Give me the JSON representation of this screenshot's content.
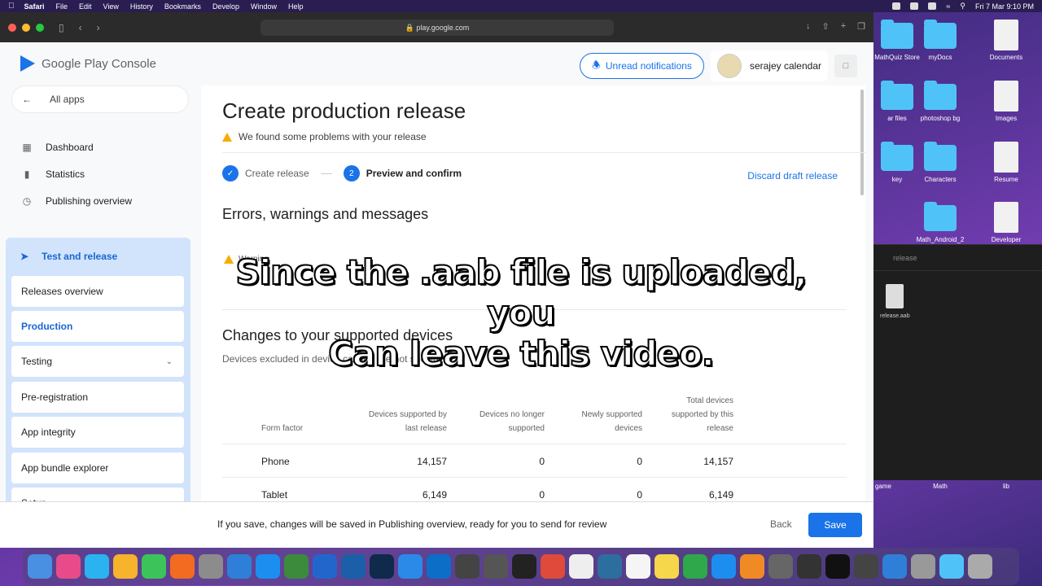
{
  "menubar": {
    "app": "Safari",
    "items": [
      "File",
      "Edit",
      "View",
      "History",
      "Bookmarks",
      "Develop",
      "Window",
      "Help"
    ],
    "datetime": "Fri 7 Mar  9:10 PM"
  },
  "browser": {
    "url": "play.google.com"
  },
  "desktop": {
    "icons": [
      {
        "label": "MathQuiz\nStore",
        "type": "folder"
      },
      {
        "label": "myDocs",
        "type": "folder"
      },
      {
        "label": "Documents",
        "type": "doc"
      },
      {
        "label": "ar files",
        "type": "folder"
      },
      {
        "label": "photoshop bg",
        "type": "folder"
      },
      {
        "label": "Images",
        "type": "doc"
      },
      {
        "label": "key",
        "type": "folder"
      },
      {
        "label": "Characters",
        "type": "folder"
      },
      {
        "label": "Resume",
        "type": "doc"
      },
      {
        "label": "Math_Android_2",
        "type": "folder"
      },
      {
        "label": "Developer",
        "type": "doc"
      }
    ],
    "bottom_labels": [
      "game",
      "Math",
      "lib"
    ],
    "finder_title": "release",
    "finder_file": "release.aab"
  },
  "console": {
    "brand": "Google Play Console",
    "notifications_label": "Unread notifications",
    "account_name": "serajey calendar",
    "all_apps": "All apps",
    "nav": [
      {
        "label": "Dashboard",
        "icon": "dashboard-icon"
      },
      {
        "label": "Statistics",
        "icon": "bar-chart-icon"
      },
      {
        "label": "Publishing overview",
        "icon": "publish-icon"
      }
    ],
    "test_release": "Test and release",
    "sub_items": [
      {
        "label": "Releases overview"
      },
      {
        "label": "Production"
      },
      {
        "label": "Testing"
      },
      {
        "label": "Pre-registration"
      },
      {
        "label": "App integrity"
      },
      {
        "label": "App bundle explorer"
      },
      {
        "label": "Setup"
      }
    ]
  },
  "main": {
    "title": "Create production release",
    "warning": "We found some problems with your release",
    "step1": "Create release",
    "step2_num": "2",
    "step2": "Preview and confirm",
    "discard": "Discard draft release",
    "errors_heading": "Errors, warnings and messages",
    "warning_chip": "Warning",
    "devices_heading": "Changes to your supported devices",
    "devices_sub": "Devices excluded in device catalog are not shown",
    "table": {
      "headers": [
        "Form factor",
        "Devices supported by last release",
        "Devices no longer supported",
        "Newly supported devices",
        "Total devices supported by this release"
      ],
      "rows": [
        [
          "Phone",
          "14,157",
          "0",
          "0",
          "14,157"
        ],
        [
          "Tablet",
          "6,149",
          "0",
          "0",
          "6,149"
        ]
      ]
    }
  },
  "caption": {
    "line1": "Since the .aab file is uploaded, you",
    "line2": "Can leave this video."
  },
  "footer": {
    "message": "If you save, changes will be saved in Publishing overview, ready for you to send for review",
    "back": "Back",
    "save": "Save"
  },
  "colors": {
    "primary": "#1a73e8",
    "nav_highlight": "#d2e3fc",
    "warning": "#f9ab00"
  }
}
